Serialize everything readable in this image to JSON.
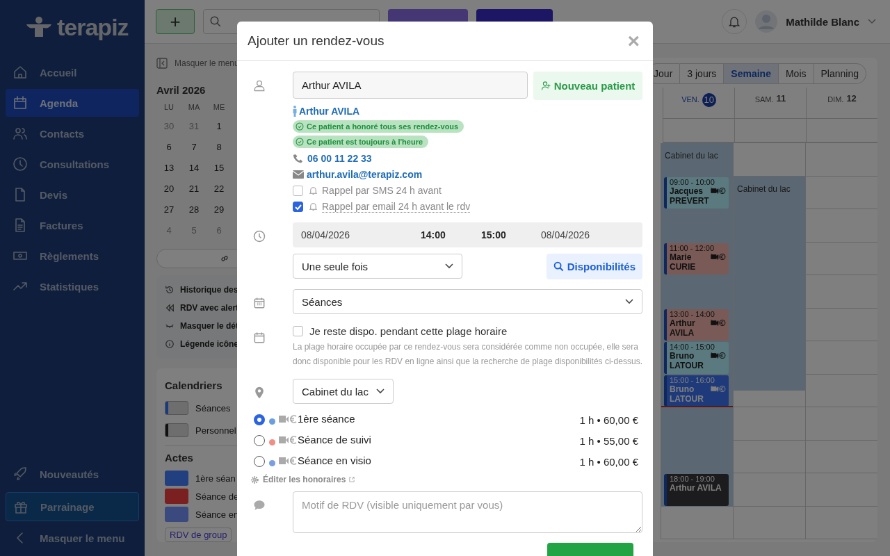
{
  "sidebar": {
    "logo": "terapiz",
    "items": [
      {
        "label": "Accueil",
        "selected": false
      },
      {
        "label": "Agenda",
        "selected": true
      },
      {
        "label": "Contacts",
        "selected": false
      },
      {
        "label": "Consultations",
        "selected": false
      },
      {
        "label": "Devis",
        "selected": false
      },
      {
        "label": "Factures",
        "selected": false
      },
      {
        "label": "Règlements",
        "selected": false
      },
      {
        "label": "Statistiques",
        "selected": false
      }
    ],
    "bottom_items": [
      {
        "label": "Nouveautés",
        "kind": "news"
      },
      {
        "label": "Parrainage",
        "kind": "promo"
      },
      {
        "label": "Masquer le menu",
        "kind": "collapse"
      }
    ]
  },
  "topbar": {
    "add_button": "+",
    "user": "Mathilde Blanc"
  },
  "left_panel": {
    "hide_menu": "Masquer le menu",
    "month": "Avril 2026",
    "weekdays": [
      "LU",
      "MA",
      "ME"
    ],
    "weeks": [
      [
        {
          "day": "30",
          "muted": true
        },
        {
          "day": "31",
          "muted": true
        },
        {
          "day": "1",
          "muted": false
        }
      ],
      [
        {
          "day": "6",
          "muted": false
        },
        {
          "day": "7",
          "muted": false
        },
        {
          "day": "8",
          "muted": false
        }
      ],
      [
        {
          "day": "13",
          "muted": false
        },
        {
          "day": "14",
          "muted": false
        },
        {
          "day": "15",
          "muted": false
        }
      ],
      [
        {
          "day": "20",
          "muted": false
        },
        {
          "day": "21",
          "muted": false
        },
        {
          "day": "22",
          "muted": false
        }
      ],
      [
        {
          "day": "27",
          "muted": false
        },
        {
          "day": "28",
          "muted": false
        },
        {
          "day": "29",
          "muted": false
        }
      ],
      [
        {
          "day": "4",
          "muted": true
        },
        {
          "day": "5",
          "muted": true
        },
        {
          "day": "6",
          "muted": true
        }
      ]
    ],
    "tools": [
      "Historique des",
      "RDV avec alert",
      "Masquer le dét",
      "Légende icône"
    ],
    "calendars": {
      "title": "Calendriers",
      "items": [
        {
          "label": "Séances",
          "color": "#1a3a80"
        },
        {
          "label": "Personnel",
          "color": "#111111"
        }
      ]
    },
    "acts": {
      "title": "Actes",
      "items": [
        {
          "label": "1ère séan",
          "color": "#22408a"
        },
        {
          "label": "Séance de",
          "color": "#7a2020"
        },
        {
          "label": "Séance en",
          "color": "#3a4a7e"
        }
      ]
    },
    "group_link": "RDV de group"
  },
  "calendar": {
    "views": [
      {
        "label": "Jour",
        "selected": false
      },
      {
        "label": "3 jours",
        "selected": false
      },
      {
        "label": "Semaine",
        "selected": true
      },
      {
        "label": "Mois",
        "selected": false
      },
      {
        "label": "Planning",
        "selected": false
      }
    ],
    "days": [
      {
        "weekday": "VEN.",
        "date": "10",
        "today": true,
        "availability": {
          "label": "Cabinet du lac"
        },
        "events": [
          {
            "time": "09:00 - 10:00",
            "name": "Jacques PREVERT",
            "color": "#5a7a7f",
            "icons": true
          },
          {
            "time": "11:00 - 12:00",
            "name": "Marie CURIE",
            "color": "#7a5a56",
            "icons": true
          },
          {
            "time": "13:00 - 14:00",
            "name": "Arthur AVILA",
            "color": "#7a5a56",
            "icons": true
          },
          {
            "time": "14:00 - 15:00",
            "name": "Bruno LATOUR",
            "color": "#5a7a7f",
            "icons": true
          },
          {
            "time": "15:00 - 16:00",
            "name": "Bruno LATOUR",
            "color": "#1f3a7a",
            "icons": true
          },
          {
            "time": "18:00 - 19:00",
            "name": "Arthur AVILA",
            "color": "#1c1c1e",
            "icons": false
          }
        ]
      },
      {
        "weekday": "SAM.",
        "date": "11",
        "today": false,
        "availability": {
          "label": "Cabinet du lac"
        }
      },
      {
        "weekday": "DIM.",
        "date": "12",
        "today": false
      }
    ]
  },
  "modal": {
    "title": "Ajouter un rendez-vous",
    "close": "×",
    "patient": {
      "value": "Arthur AVILA",
      "new_button": "Nouveau patient",
      "link": "Arthur AVILA",
      "badges": [
        "Ce patient a honoré tous ses rendez-vous",
        "Ce patient est toujours à l'heure"
      ],
      "phone": "06 00 11 22 33",
      "email": "arthur.avila@terapiz.com"
    },
    "reminders": [
      {
        "label": "Rappel par SMS 24 h avant",
        "checked": false
      },
      {
        "label": "Rappel par email 24 h avant le rdv",
        "checked": true
      }
    ],
    "schedule": {
      "start_date": "08/04/2026",
      "start_time": "14:00",
      "end_time": "15:00",
      "end_date": "08/04/2026"
    },
    "recurrence": "Une seule fois",
    "availability_button": "Disponibilités",
    "calendar": "Séances",
    "stay_available": {
      "label": "Je reste dispo. pendant cette plage horaire",
      "checked": false,
      "help": "La plage horaire occupée par ce rendez-vous sera considérée comme non occupée, elle sera donc disponible pour les RDV en ligne ainsi que la recherche de plage disponibilités ci-dessus."
    },
    "location": "Cabinet du lac",
    "acts": [
      {
        "label": "1ère séance",
        "color": "#6a9ee0",
        "selected": true,
        "price": "1 h • 60,00 €"
      },
      {
        "label": "Séance de suivi",
        "color": "#ee8e84",
        "selected": false,
        "price": "1 h • 55,00 €"
      },
      {
        "label": "Séance en visio",
        "color": "#7a9ee0",
        "selected": false,
        "price": "1 h • 60,00 €"
      }
    ],
    "edit_fees": "Éditer les honoraires",
    "reason": {
      "placeholder": "Motif de RDV (visible uniquement par vous)"
    }
  }
}
